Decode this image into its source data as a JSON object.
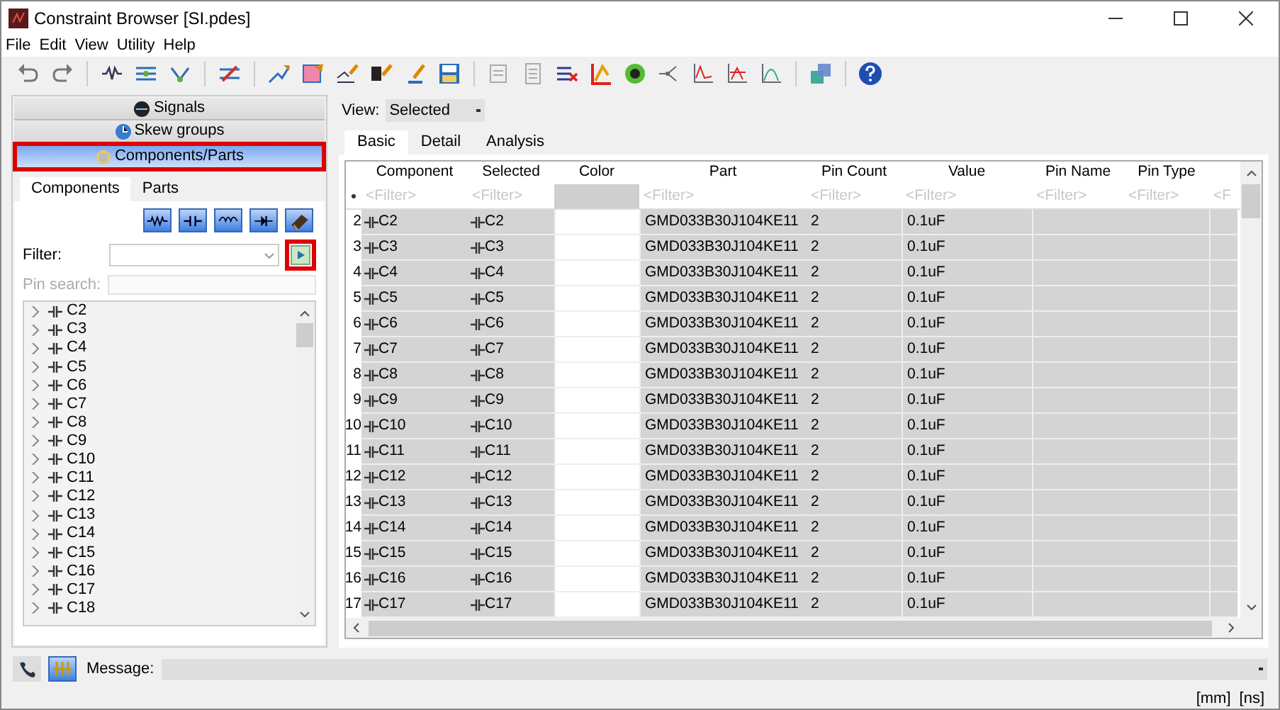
{
  "window": {
    "title": "Constraint Browser [SI.pdes]"
  },
  "menu": [
    "File",
    "Edit",
    "View",
    "Utility",
    "Help"
  ],
  "sections": [
    {
      "label": "Signals",
      "selected": false,
      "highlighted": false
    },
    {
      "label": "Skew groups",
      "selected": false,
      "highlighted": false
    },
    {
      "label": "Components/Parts",
      "selected": true,
      "highlighted": true
    }
  ],
  "left_tabs": [
    {
      "label": "Components",
      "selected": true
    },
    {
      "label": "Parts",
      "selected": false
    }
  ],
  "filter": {
    "label": "Filter:",
    "apply_highlighted": true
  },
  "pin_search": {
    "label": "Pin search:",
    "disabled": true
  },
  "tree": [
    {
      "label": "C2",
      "expanded": false
    },
    {
      "label": "C3",
      "expanded": false
    },
    {
      "label": "C4",
      "expanded": false
    },
    {
      "label": "C5",
      "expanded": false
    },
    {
      "label": "C6",
      "expanded": false
    },
    {
      "label": "C7",
      "expanded": false
    },
    {
      "label": "C8",
      "expanded": false
    },
    {
      "label": "C9",
      "expanded": false
    },
    {
      "label": "C10",
      "expanded": false
    },
    {
      "label": "C11",
      "expanded": false
    },
    {
      "label": "C12",
      "expanded": false
    },
    {
      "label": "C13",
      "expanded": false
    },
    {
      "label": "C14",
      "expanded": false
    },
    {
      "label": "C15",
      "expanded": false
    },
    {
      "label": "C16",
      "expanded": false
    },
    {
      "label": "C17",
      "expanded": false
    },
    {
      "label": "C18",
      "expanded": false
    }
  ],
  "view": {
    "label": "View:",
    "value": "Selected"
  },
  "tabs": [
    {
      "label": "Basic",
      "selected": true
    },
    {
      "label": "Detail",
      "selected": false
    },
    {
      "label": "Analysis",
      "selected": false
    }
  ],
  "table": {
    "columns": [
      {
        "label": "Component",
        "filter": "<Filter>"
      },
      {
        "label": "Selected",
        "filter": "<Filter>"
      },
      {
        "label": "Color"
      },
      {
        "label": "Part",
        "filter": "<Filter>"
      },
      {
        "label": "Pin Count",
        "filter": "<Filter>"
      },
      {
        "label": "Value",
        "filter": "<Filter>"
      },
      {
        "label": "Pin Name",
        "filter": "<Filter>"
      },
      {
        "label": "Pin Type",
        "filter": "<Filter>"
      },
      {
        "filter": "<F"
      }
    ],
    "rows": [
      {
        "number": "2",
        "component": "C2",
        "selected": "C2",
        "part": "GMD033B30J104KE11",
        "pin_count": "2",
        "value": "0.1uF"
      },
      {
        "number": "3",
        "component": "C3",
        "selected": "C3",
        "part": "GMD033B30J104KE11",
        "pin_count": "2",
        "value": "0.1uF"
      },
      {
        "number": "4",
        "component": "C4",
        "selected": "C4",
        "part": "GMD033B30J104KE11",
        "pin_count": "2",
        "value": "0.1uF"
      },
      {
        "number": "5",
        "component": "C5",
        "selected": "C5",
        "part": "GMD033B30J104KE11",
        "pin_count": "2",
        "value": "0.1uF"
      },
      {
        "number": "6",
        "component": "C6",
        "selected": "C6",
        "part": "GMD033B30J104KE11",
        "pin_count": "2",
        "value": "0.1uF"
      },
      {
        "number": "7",
        "component": "C7",
        "selected": "C7",
        "part": "GMD033B30J104KE11",
        "pin_count": "2",
        "value": "0.1uF"
      },
      {
        "number": "8",
        "component": "C8",
        "selected": "C8",
        "part": "GMD033B30J104KE11",
        "pin_count": "2",
        "value": "0.1uF"
      },
      {
        "number": "9",
        "component": "C9",
        "selected": "C9",
        "part": "GMD033B30J104KE11",
        "pin_count": "2",
        "value": "0.1uF"
      },
      {
        "number": "10",
        "component": "C10",
        "selected": "C10",
        "part": "GMD033B30J104KE11",
        "pin_count": "2",
        "value": "0.1uF"
      },
      {
        "number": "11",
        "component": "C11",
        "selected": "C11",
        "part": "GMD033B30J104KE11",
        "pin_count": "2",
        "value": "0.1uF"
      },
      {
        "number": "12",
        "component": "C12",
        "selected": "C12",
        "part": "GMD033B30J104KE11",
        "pin_count": "2",
        "value": "0.1uF"
      },
      {
        "number": "13",
        "component": "C13",
        "selected": "C13",
        "part": "GMD033B30J104KE11",
        "pin_count": "2",
        "value": "0.1uF"
      },
      {
        "number": "14",
        "component": "C14",
        "selected": "C14",
        "part": "GMD033B30J104KE11",
        "pin_count": "2",
        "value": "0.1uF"
      },
      {
        "number": "15",
        "component": "C15",
        "selected": "C15",
        "part": "GMD033B30J104KE11",
        "pin_count": "2",
        "value": "0.1uF"
      },
      {
        "number": "16",
        "component": "C16",
        "selected": "C16",
        "part": "GMD033B30J104KE11",
        "pin_count": "2",
        "value": "0.1uF"
      },
      {
        "number": "17",
        "component": "C17",
        "selected": "C17",
        "part": "GMD033B30J104KE11",
        "pin_count": "2",
        "value": "0.1uF"
      }
    ]
  },
  "message": {
    "label": "Message:"
  },
  "status_bar": [
    "[mm]",
    "[ns]"
  ]
}
